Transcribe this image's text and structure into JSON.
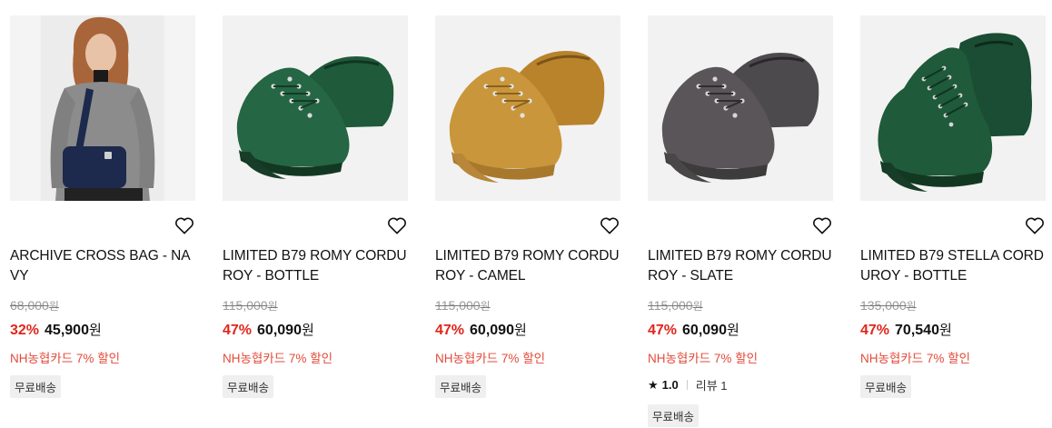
{
  "currency_unit": "원",
  "products": [
    {
      "name": "ARCHIVE CROSS BAG - NAVY",
      "image": "model-with-navy-cross-bag",
      "original_price": "68,000",
      "discount": "32%",
      "sale_price": "45,900",
      "promo": "NH농협카드 7% 할인",
      "tag": "무료배송"
    },
    {
      "name": "LIMITED B79 ROMY CORDUROY - BOTTLE",
      "image": "green-corduroy-low-sneakers",
      "original_price": "115,000",
      "discount": "47%",
      "sale_price": "60,090",
      "promo": "NH농협카드 7% 할인",
      "tag": "무료배송"
    },
    {
      "name": "LIMITED B79 ROMY CORDUROY - CAMEL",
      "image": "camel-corduroy-low-sneakers",
      "original_price": "115,000",
      "discount": "47%",
      "sale_price": "60,090",
      "promo": "NH농협카드 7% 할인",
      "tag": "무료배송"
    },
    {
      "name": "LIMITED B79 ROMY CORDUROY - SLATE",
      "image": "slate-corduroy-low-sneakers",
      "original_price": "115,000",
      "discount": "47%",
      "sale_price": "60,090",
      "promo": "NH농협카드 7% 할인",
      "rating": "1.0",
      "review_label": "리뷰 1",
      "tag": "무료배송"
    },
    {
      "name": "LIMITED B79 STELLA CORDUROY - BOTTLE",
      "image": "green-corduroy-high-sneakers",
      "original_price": "135,000",
      "discount": "47%",
      "sale_price": "70,540",
      "promo": "NH농협카드 7% 할인",
      "tag": "무료배송"
    }
  ],
  "colors": {
    "discount": "#e0261b",
    "promo": "#e34a3a",
    "bottle_green": "#1f5a3a",
    "camel": "#c9963b",
    "slate": "#5a5558",
    "navy": "#1d2a4d"
  },
  "icons": {
    "wishlist": "heart-outline-icon",
    "rating": "star-icon"
  }
}
